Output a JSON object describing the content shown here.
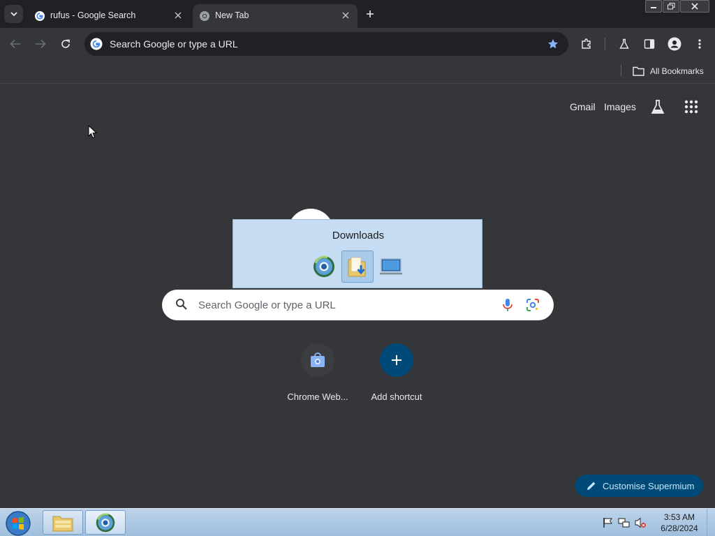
{
  "browser": {
    "tabs": [
      {
        "title": "rufus - Google Search",
        "favicon": "google-g-icon",
        "active": false
      },
      {
        "title": "New Tab",
        "favicon": "chrome-icon",
        "active": true
      }
    ],
    "omnibox_text": "Search Google or type a URL",
    "bookmarks_bar": {
      "all_bookmarks_label": "All Bookmarks"
    }
  },
  "ntp": {
    "top_links": {
      "gmail": "Gmail",
      "images": "Images"
    },
    "search_placeholder": "Search Google or type a URL",
    "shortcuts": [
      {
        "label": "Chrome Web...",
        "icon": "web-store-icon"
      },
      {
        "label": "Add shortcut",
        "icon": "plus-icon"
      }
    ],
    "customise_label": "Customise Supermium"
  },
  "downloads_popup": {
    "title": "Downloads",
    "items": [
      {
        "icon": "browser-globe-icon"
      },
      {
        "icon": "downloads-folder-icon",
        "selected": true
      },
      {
        "icon": "computer-icon"
      }
    ]
  },
  "taskbar": {
    "time": "3:53 AM",
    "date": "6/28/2024",
    "apps": [
      "file-explorer-icon",
      "browser-globe-icon"
    ]
  },
  "colors": {
    "browser_dark": "#202124",
    "ntp_bg": "#35363a",
    "accent_blue": "#8ab4f8",
    "customise_bg": "#004a77"
  }
}
